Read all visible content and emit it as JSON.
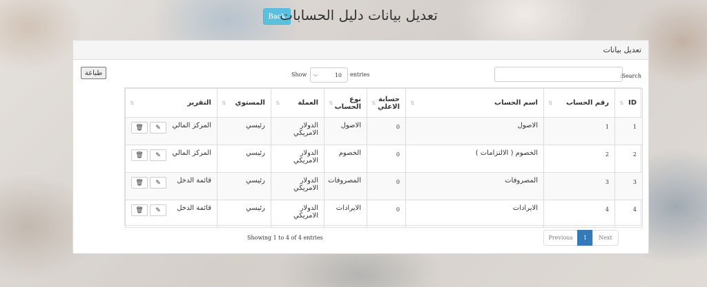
{
  "header": {
    "title": "تعديل بيانات دليل الحسابات",
    "back_label": "Back"
  },
  "panel": {
    "heading": "تعديل بيانات",
    "search_label": ":Search",
    "show_label": "Show",
    "length_value": "10",
    "entries_label": "entries",
    "print_label": "طباعة"
  },
  "table": {
    "columns": [
      "ID",
      "رقم الحساب",
      "اسم الحساب",
      "حسابة الاعلي",
      "نوع الحساب",
      "العملة",
      "المستوي",
      "التقرير"
    ],
    "rows": [
      {
        "id": "1",
        "account_no": "1",
        "name": "الاصول",
        "parent": "0",
        "type": "الاصول",
        "currency": "الدولار الامريكي",
        "level": "رئيسي",
        "report": "المركز المالي"
      },
      {
        "id": "2",
        "account_no": "2",
        "name": "الخصوم ( الالتزامات )",
        "parent": "0",
        "type": "الخصوم",
        "currency": "الدولار الامريكي",
        "level": "رئيسي",
        "report": "المركز المالي"
      },
      {
        "id": "3",
        "account_no": "3",
        "name": "المصروفات",
        "parent": "0",
        "type": "المصروفات",
        "currency": "الدولار الامريكي",
        "level": "رئيسي",
        "report": "قائمة الدخل"
      },
      {
        "id": "4",
        "account_no": "4",
        "name": "الايرادات",
        "parent": "0",
        "type": "الايرادات",
        "currency": "الدولار الامريكي",
        "level": "رئيسي",
        "report": "قائمة الدخل"
      }
    ]
  },
  "footer": {
    "info": "Showing 1 to 4 of 4 entries",
    "previous": "Previous",
    "page": "1",
    "next": "Next"
  },
  "icons": {
    "edit": "pencil-icon",
    "delete": "trash-icon",
    "sort": "sort-icon"
  },
  "colors": {
    "back_button": "#5bc0de",
    "active_page": "#337ab7"
  }
}
